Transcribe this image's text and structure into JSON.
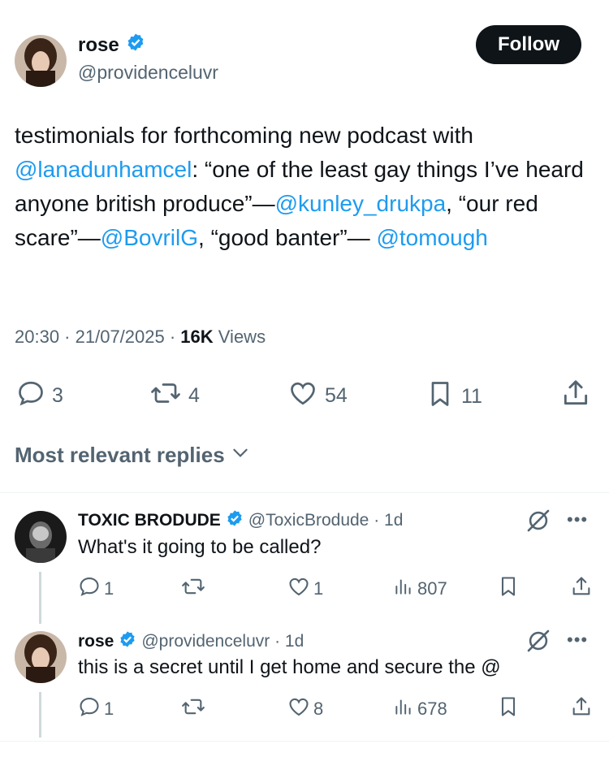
{
  "tweet": {
    "author_name": "rose",
    "author_handle": "@providenceluvr",
    "follow_label": "Follow",
    "text_1": "testimonials for forthcoming new podcast with",
    "mention_1": "@lanadunhamcel",
    "text_2": ": “one of the least gay things I’ve heard anyone british produce”—",
    "mention_2": "@kunley_drukpa",
    "text_3": ", “our red scare”—",
    "mention_3": "@BovrilG",
    "text_4": ", “good banter”—",
    "mention_4": "@tomough",
    "time": "20:30",
    "date": "21/07/2025",
    "views_count": "16K",
    "views_label": "Views",
    "replies": "3",
    "reposts": "4",
    "likes": "54",
    "bookmarks": "11"
  },
  "replies_section": {
    "title": "Most relevant replies"
  },
  "replies": [
    {
      "name": "TOXIC BRODUDE",
      "handle": "@ToxicBrodude · 1d",
      "text": "What's it going to be called?",
      "replies": "1",
      "reposts": "",
      "likes": "1",
      "views": "807"
    },
    {
      "name": "rose",
      "handle": "@providenceluvr · 1d",
      "text": "this is a secret until I get home and secure the @",
      "replies": "1",
      "reposts": "",
      "likes": "8",
      "views": "678"
    }
  ],
  "colors": {
    "accent": "#1d9bf0",
    "text": "#0f1419",
    "muted": "#536471"
  }
}
